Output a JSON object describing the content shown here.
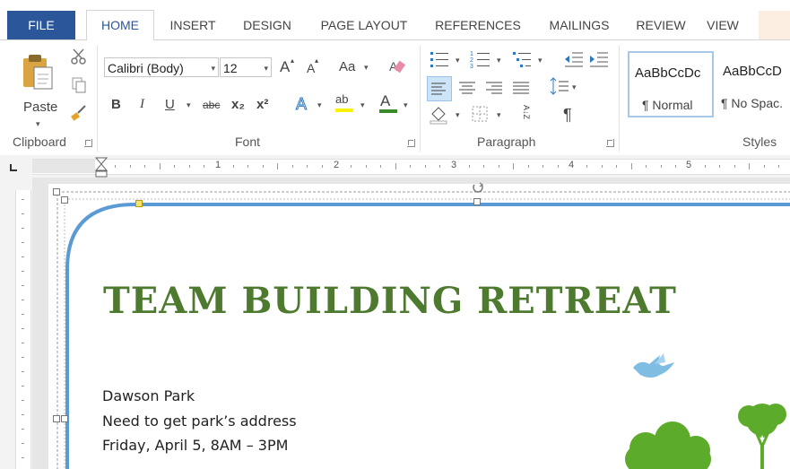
{
  "tabs": {
    "file": "FILE",
    "home": "HOME",
    "insert": "INSERT",
    "design": "DESIGN",
    "page_layout": "PAGE LAYOUT",
    "references": "REFERENCES",
    "mailings": "MAILINGS",
    "review": "REVIEW",
    "view": "VIEW"
  },
  "clipboard": {
    "paste_label": "Paste",
    "group_label": "Clipboard"
  },
  "font": {
    "name": "Calibri (Body)",
    "size": "12",
    "grow": "A",
    "shrink": "A",
    "change_case": "Aa",
    "bold": "B",
    "italic": "I",
    "underline": "U",
    "strikethrough": "abc",
    "subscript": "x₂",
    "superscript": "x²",
    "text_effects": "A",
    "highlight": "ab",
    "font_color": "A",
    "group_label": "Font"
  },
  "paragraph": {
    "sort": "A↓Z",
    "show_marks": "¶",
    "group_label": "Paragraph"
  },
  "styles": {
    "items": [
      {
        "sample": "AaBbCcDc",
        "name": "¶ Normal"
      },
      {
        "sample": "AaBbCcD",
        "name": "¶ No Spac."
      }
    ],
    "group_label": "Styles"
  },
  "ruler": {
    "numbers": [
      "1",
      "2",
      "3",
      "4",
      "5"
    ]
  },
  "document": {
    "title": "TEAM BUILDING RETREAT",
    "lines": [
      "Dawson Park",
      "Need to get park’s address",
      "Friday, April 5, 8AM – 3PM"
    ]
  },
  "colors": {
    "file_tab": "#2b579a",
    "title_green": "#4e7a2f",
    "border_blue": "#5b9bd5",
    "tree_green": "#5dab2a",
    "bird_blue": "#7fbde3"
  }
}
